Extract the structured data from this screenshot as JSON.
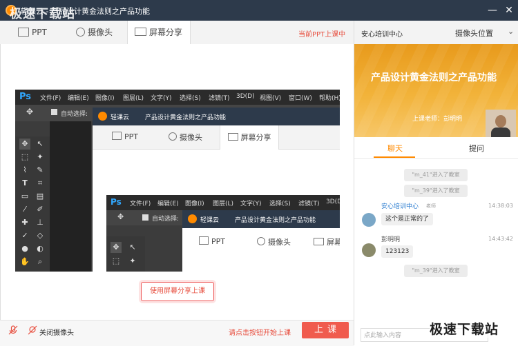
{
  "window": {
    "title": "轻课云 - 产品设计黄金法则之产品功能",
    "watermark": "极速下载站"
  },
  "tabs": [
    {
      "label": "PPT",
      "icon": "ppt-icon"
    },
    {
      "label": "摄像头",
      "icon": "camera-icon"
    },
    {
      "label": "屏幕分享",
      "icon": "monitor-icon",
      "active": true
    }
  ],
  "ppt_status": "当前PPT上课中",
  "share_button": "使用屏幕分享上课",
  "photoshop": {
    "logo": "Ps",
    "menus": [
      "文件(F)",
      "编辑(E)",
      "图像(I)",
      "图层(L)",
      "文字(Y)",
      "选择(S)",
      "滤镜(T)",
      "3D(D)",
      "视图(V)",
      "窗口(W)",
      "帮助(H)"
    ],
    "auto_select": "自动选择:",
    "inner_app_name": "轻课云",
    "inner_title": "产品设计黄金法则之产品功能"
  },
  "bottom": {
    "close_camera": "关闭摄像头",
    "hint": "请点击按钮开始上课",
    "start_button": "上课"
  },
  "right_panel": {
    "org_name": "安心培训中心",
    "camera_position": "摄像头位置",
    "video_title": "产品设计黄金法则之产品功能",
    "teacher": "上课老师：彭明明",
    "chat_tabs": [
      "聊天",
      "提问"
    ],
    "messages": [
      {
        "type": "system",
        "text": "\"m_41\"进入了教室"
      },
      {
        "type": "system",
        "text": "\"m_39\"进入了教室"
      },
      {
        "type": "chat",
        "name": "安心培训中心",
        "role": "老师",
        "time": "14:38:03",
        "text": "这个是正常的了"
      },
      {
        "type": "chat",
        "name": "彭明明",
        "role": "",
        "time": "14:43:42",
        "text": "123123"
      },
      {
        "type": "system",
        "text": "\"m_39\"进入了教室"
      }
    ],
    "input_placeholder": "点此输入内容"
  },
  "colors": {
    "titlebar": "#2d3a4b",
    "accent": "#f05b4e",
    "chat_tab_active": "#ff8a00",
    "video_bg": "#f2b33a"
  }
}
